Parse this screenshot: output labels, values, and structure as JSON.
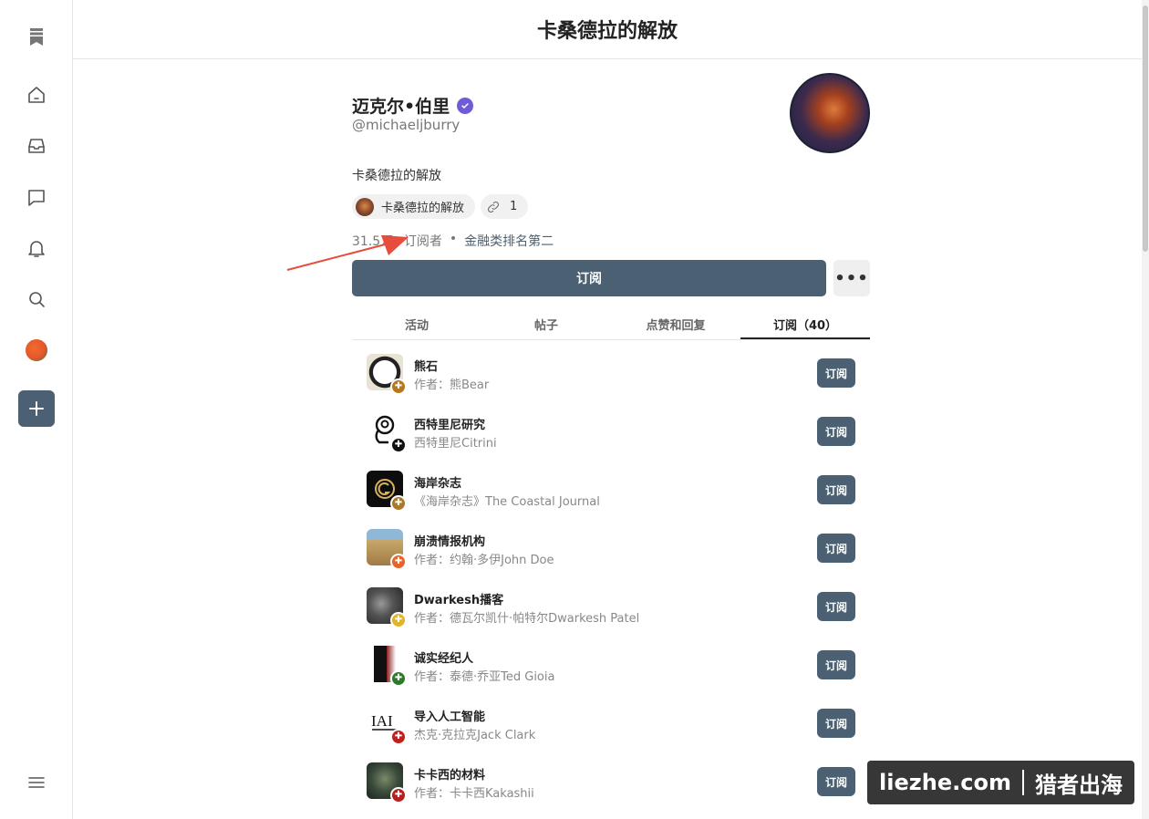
{
  "header": {
    "title": "卡桑德拉的解放"
  },
  "sidebar": {
    "icons": [
      "bookmark-icon",
      "home-icon",
      "inbox-icon",
      "chat-icon",
      "bell-icon",
      "search-icon",
      "publication-avatar",
      "plus-icon",
      "menu-icon"
    ]
  },
  "profile": {
    "name": "迈克尔•伯里",
    "handle": "@michaeljburry",
    "bio": "卡桑德拉的解放",
    "chip_publication": "卡桑德拉的解放",
    "chip_links_count": "1",
    "subscribers": "31.5万+订阅者",
    "separator": "•",
    "ranking": "金融类排名第二",
    "subscribe_label": "订阅",
    "more_label": "•••"
  },
  "tabs": [
    {
      "label": "活动"
    },
    {
      "label": "帖子"
    },
    {
      "label": "点赞和回复"
    },
    {
      "label": "订阅（40）"
    }
  ],
  "subscriptions": [
    {
      "title": "熊石",
      "subtitle": "作者：熊Bear",
      "button": "订阅",
      "badge_color": "#b5781f"
    },
    {
      "title": "西特里尼研究",
      "subtitle": "西特里尼Citrini",
      "button": "订阅",
      "badge_color": "#111111"
    },
    {
      "title": "海岸杂志",
      "subtitle": "《海岸杂志》The Coastal Journal",
      "button": "订阅",
      "badge_color": "#a87a2a"
    },
    {
      "title": "崩溃情报机构",
      "subtitle": "作者：约翰·多伊John Doe",
      "button": "订阅",
      "badge_color": "#e8642a"
    },
    {
      "title": "Dwarkesh播客",
      "subtitle": "作者：德瓦尔凯什·帕特尔Dwarkesh Patel",
      "button": "订阅",
      "badge_color": "#e0b52a"
    },
    {
      "title": "诚实经纪人",
      "subtitle": "作者：泰德·乔亚Ted Gioia",
      "button": "订阅",
      "badge_color": "#2f7a2a"
    },
    {
      "title": "导入人工智能",
      "subtitle": "杰克·克拉克Jack Clark",
      "button": "订阅",
      "badge_color": "#c2201f"
    },
    {
      "title": "卡卡西的材料",
      "subtitle": "作者：卡卡西Kakashii",
      "button": "订阅",
      "badge_color": "#b52020"
    }
  ],
  "watermark": {
    "left": "liezhe.com",
    "right": "猎者出海"
  },
  "colors": {
    "accent": "#4b6072",
    "verified": "#6e5bd6",
    "annotation_arrow": "#e74c3c"
  }
}
